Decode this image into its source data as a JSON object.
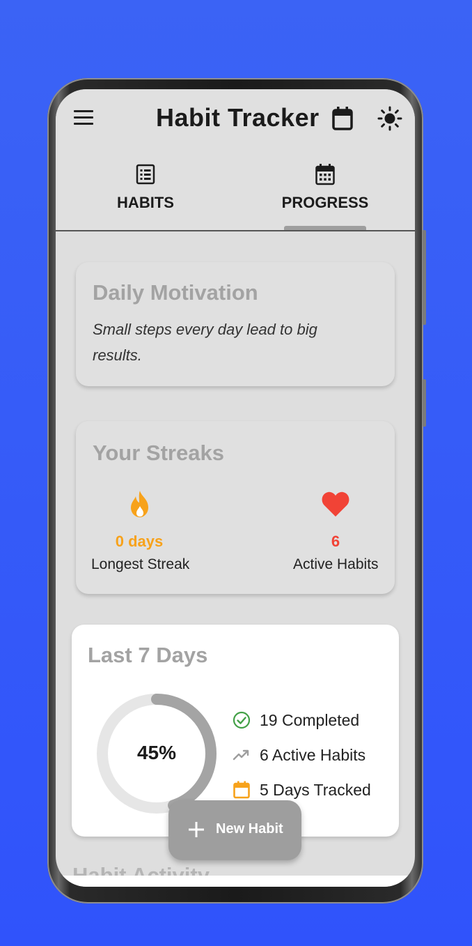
{
  "app": {
    "title": "Habit Tracker"
  },
  "tabs": [
    {
      "label": "HABITS",
      "icon": "list-icon",
      "selected": false
    },
    {
      "label": "PROGRESS",
      "icon": "calendar-icon",
      "selected": true
    }
  ],
  "motivation": {
    "title": "Daily Motivation",
    "quote": "Small steps every day lead to big results."
  },
  "streaks": {
    "title": "Your Streaks",
    "longest": {
      "value": "0 days",
      "label": "Longest Streak",
      "icon": "fire-icon",
      "color": "#f7a21b"
    },
    "active": {
      "value": "6",
      "label": "Active Habits",
      "icon": "heart-icon",
      "color": "#f14336"
    }
  },
  "last7": {
    "title": "Last 7 Days",
    "percent_label": "45%",
    "progress": 0.45,
    "completed": "19 Completed",
    "active_habits": "6 Active Habits",
    "days_tracked": "5 Days Tracked"
  },
  "fab": {
    "label": "New Habit"
  },
  "next_section": {
    "title": "Habit Activity"
  },
  "colors": {
    "background": "#3b63f5",
    "accent_orange": "#f7a21b",
    "accent_red": "#f14336",
    "accent_green": "#43a047"
  }
}
